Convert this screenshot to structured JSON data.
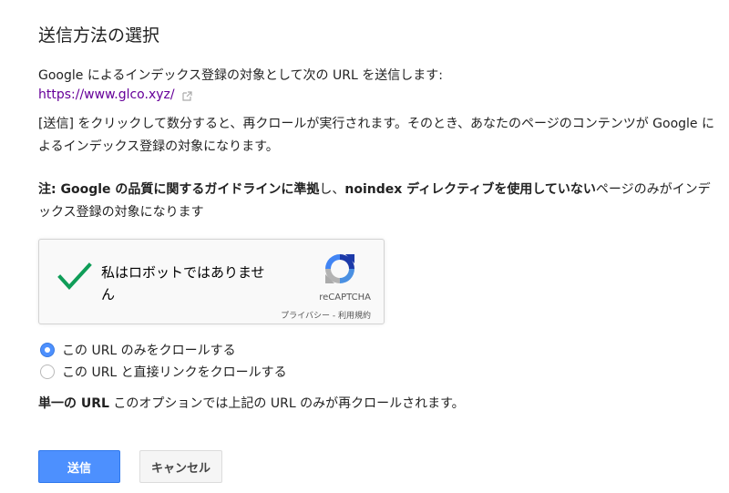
{
  "dialog": {
    "title": "送信方法の選択",
    "intro": "Google によるインデックス登録の対象として次の URL を送信します:",
    "url": "https://www.glco.xyz/",
    "submit_paragraph": "[送信] をクリックして数分すると、再クロールが実行されます。そのとき、あなたのページのコンテンツが Google によるインデックス登録の対象になります。",
    "note": {
      "prefix_bold": "注: Google の品質に関するガイドラインに準拠",
      "text_1": "し、",
      "middle_bold": "noindex ディレクティブを使用していない",
      "text_2": "ページのみがインデックス登録の対象になります"
    }
  },
  "captcha": {
    "label": "私はロボットではありません",
    "brand": "reCAPTCHA",
    "privacy_link": "プライバシー",
    "separator": " - ",
    "terms_link": "利用規約",
    "checked": true,
    "check_color": "#0f9d58"
  },
  "options": [
    {
      "label": "この URL のみをクロールする",
      "selected": true
    },
    {
      "label": "この URL と直接リンクをクロールする",
      "selected": false
    }
  ],
  "option_description": {
    "bold": "単一の URL",
    "text": " このオプションでは上記の URL のみが再クロールされます。"
  },
  "buttons": {
    "submit": "送信",
    "cancel": "キャンセル"
  },
  "colors": {
    "primary_button": "#4d90fe",
    "link": "#660099"
  }
}
